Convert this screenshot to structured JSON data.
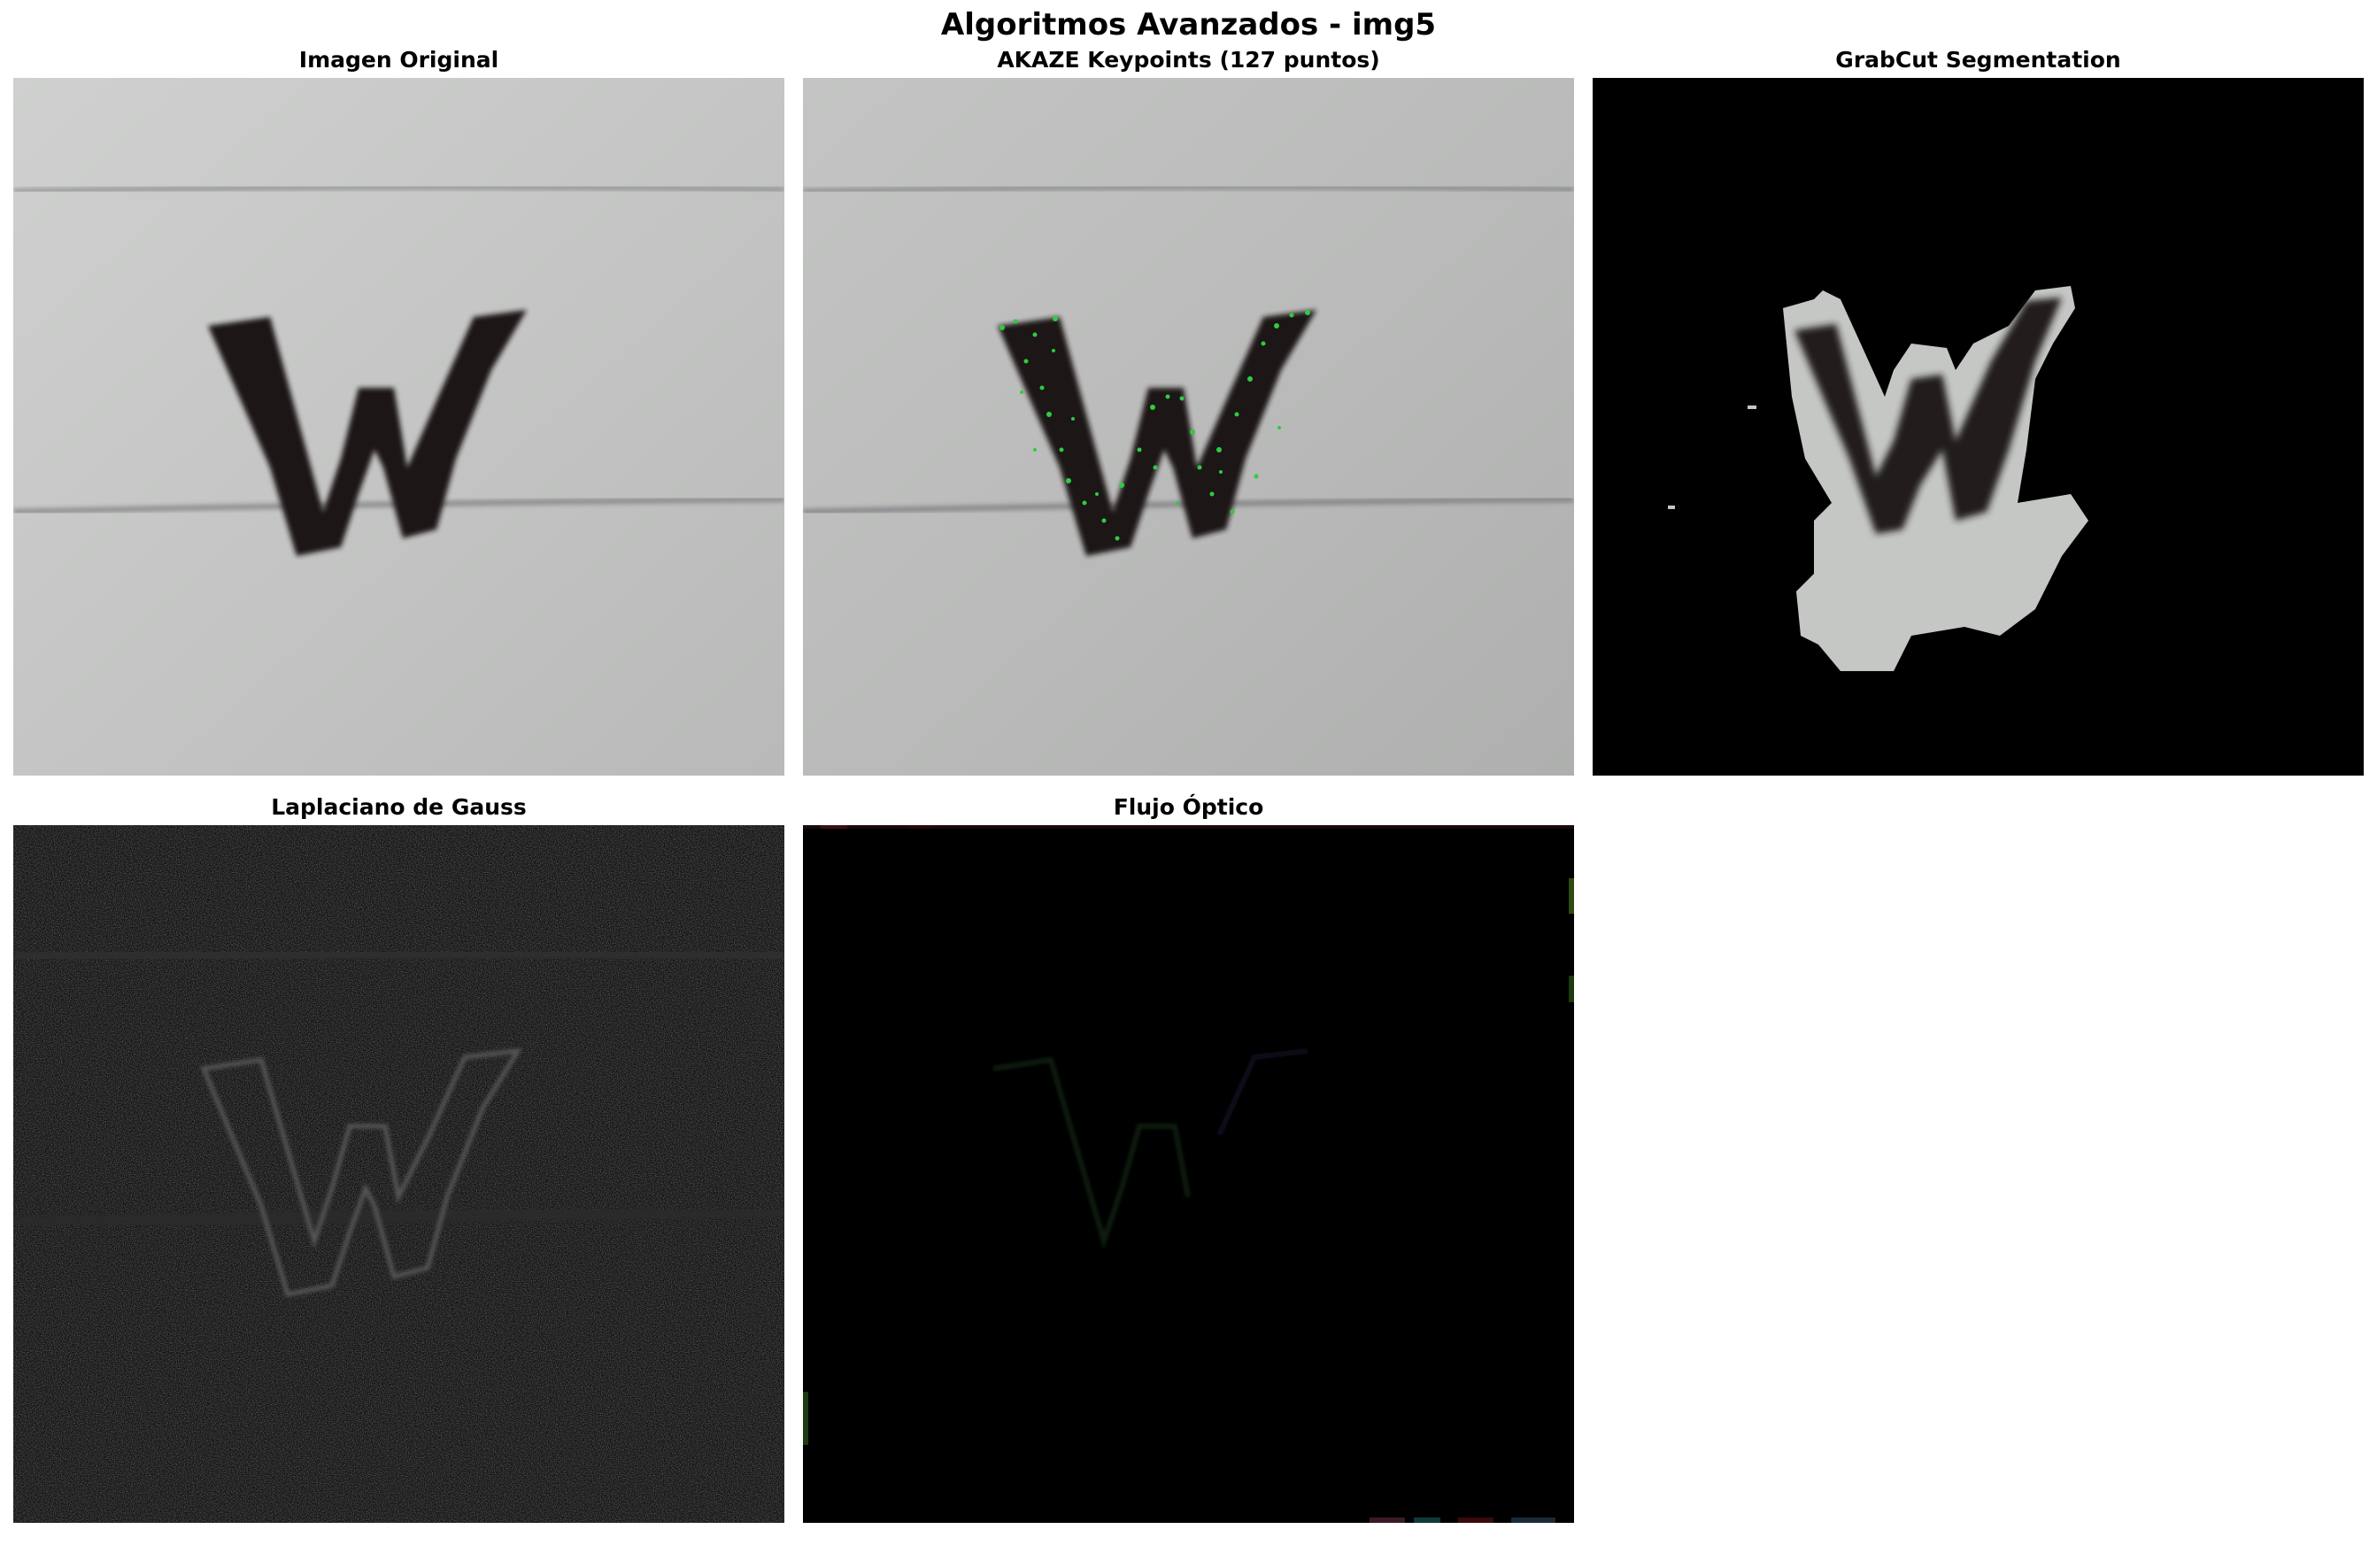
{
  "figure": {
    "title": "Algoritmos Avanzados - img5"
  },
  "panels": [
    {
      "title": "Imagen Original",
      "image": "handwritten-w-original"
    },
    {
      "title": "AKAZE Keypoints (127 puntos)",
      "image": "handwritten-w-akaze-keypoints"
    },
    {
      "title": "GrabCut Segmentation",
      "image": "handwritten-w-grabcut-mask"
    },
    {
      "title": "Laplaciano de Gauss",
      "image": "handwritten-w-laplacian-of-gaussian"
    },
    {
      "title": "Flujo Óptico",
      "image": "handwritten-w-optical-flow"
    }
  ],
  "colors": {
    "paper": "#c6c7c6",
    "ink": "#1c1718",
    "keypoint": "#2ecc40",
    "black": "#000000"
  }
}
